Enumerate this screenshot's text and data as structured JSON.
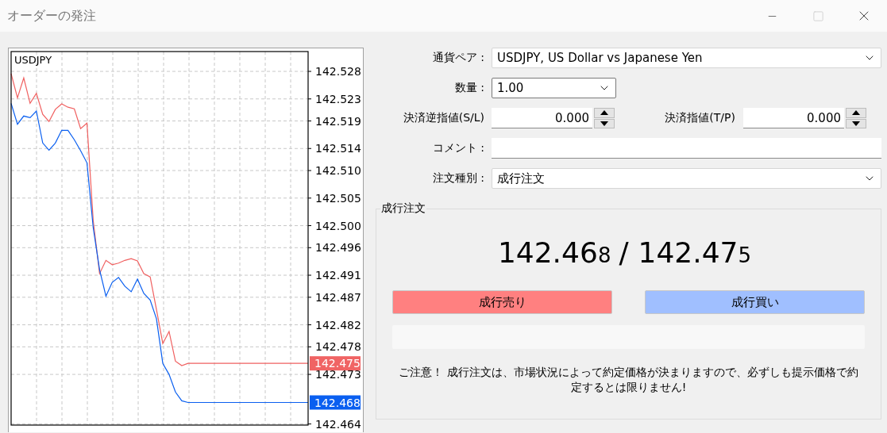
{
  "window": {
    "title": "オーダーの発注",
    "controls": [
      {
        "kind": "minimize",
        "disabled": false
      },
      {
        "kind": "maximize",
        "disabled": true
      },
      {
        "kind": "close",
        "disabled": false
      }
    ]
  },
  "chart": {
    "symbol": "USDJPY",
    "chart_data": {
      "type": "line",
      "categories": [
        null,
        null,
        null,
        null,
        null,
        null,
        null,
        null,
        null,
        null,
        null,
        null,
        null,
        null,
        null,
        null,
        null,
        null,
        null,
        null,
        null,
        null,
        null,
        null,
        null,
        null,
        null,
        null,
        null,
        null,
        null,
        null,
        null,
        null,
        null,
        null,
        null,
        null,
        null,
        null,
        null,
        null,
        null,
        null,
        null,
        null,
        null,
        null
      ],
      "series": [
        {
          "color": "#f06060",
          "values": [
            142.5276,
            142.5232,
            142.5268,
            142.5222,
            142.524,
            142.5202,
            142.5189,
            142.5211,
            142.5221,
            142.5215,
            142.5212,
            142.5176,
            142.5186,
            142.5009,
            142.4913,
            142.4937,
            142.4929,
            142.4932,
            142.4937,
            142.494,
            142.4936,
            142.4913,
            142.4907,
            142.4848,
            142.4786,
            142.4808,
            142.4754,
            142.4746,
            142.475,
            142.475,
            142.475,
            142.475,
            142.475,
            142.475,
            142.475,
            142.475,
            142.475,
            142.475,
            142.475,
            142.475,
            142.475,
            142.475,
            142.475,
            142.475,
            142.475,
            142.475,
            142.475,
            142.475
          ]
        },
        {
          "color": "#0a5ff0",
          "values": [
            142.5222,
            142.5184,
            142.5199,
            142.5196,
            142.5208,
            142.515,
            142.5137,
            142.515,
            142.5173,
            142.5173,
            142.5156,
            142.5136,
            142.5114,
            142.4996,
            142.492,
            142.4872,
            142.4897,
            142.4906,
            142.489,
            142.488,
            142.4903,
            142.4877,
            142.4865,
            142.4831,
            142.475,
            142.473,
            142.4698,
            142.4682,
            142.4679,
            142.4679,
            142.4679,
            142.4679,
            142.4679,
            142.4679,
            142.4679,
            142.4679,
            142.4679,
            142.4679,
            142.4679,
            142.4679,
            142.4679,
            142.4679,
            142.4679,
            142.4679,
            142.4679,
            142.4679,
            142.4679,
            142.4679
          ]
        }
      ],
      "ylim": [
        142.4638,
        142.5316
      ],
      "grid": true,
      "yticks": [
        {
          "value": 142.528,
          "label": "142.528"
        },
        {
          "value": 142.523,
          "label": "142.523"
        },
        {
          "value": 142.519,
          "label": "142.519"
        },
        {
          "value": 142.514,
          "label": "142.514"
        },
        {
          "value": 142.51,
          "label": "142.510"
        },
        {
          "value": 142.505,
          "label": "142.505"
        },
        {
          "value": 142.5,
          "label": "142.500"
        },
        {
          "value": 142.496,
          "label": "142.496"
        },
        {
          "value": 142.491,
          "label": "142.491"
        },
        {
          "value": 142.487,
          "label": "142.487"
        },
        {
          "value": 142.482,
          "label": "142.482"
        },
        {
          "value": 142.478,
          "label": "142.478"
        },
        {
          "value": 142.473,
          "label": "142.473"
        },
        {
          "value": 142.464,
          "label": "142.464"
        }
      ]
    },
    "price_tags": [
      {
        "label": "142.475",
        "color": "#f06464"
      },
      {
        "label": "142.468",
        "color": "#0a5ff0"
      }
    ]
  },
  "form": {
    "symbol": {
      "label": "通貨ペア :",
      "value": "USDJPY, US Dollar vs Japanese Yen"
    },
    "volume": {
      "label": "数量 :",
      "value": "1.00"
    },
    "stop_loss": {
      "label": "決済逆指値(S/L)",
      "value": "0.000"
    },
    "take_profit": {
      "label": "決済指値(T/P)",
      "value": "0.000"
    },
    "comment": {
      "label": "コメント :"
    },
    "order_type": {
      "label": "注文種別 :",
      "value": "成行注文"
    }
  },
  "order": {
    "title": "成行注文",
    "bid": {
      "main": "142.46",
      "pip": "8"
    },
    "separator": "/",
    "ask": {
      "main": "142.47",
      "pip": "5"
    },
    "buttons": [
      {
        "kind": "sell",
        "label": "成行売り"
      },
      {
        "kind": "buy",
        "label": "成行買い"
      }
    ],
    "progress": {
      "level": 0
    },
    "notice": "ご注意！ 成行注文は、市場状況によって約定価格が決まりますので、必ずしも提示価格で約定するとは限りません!"
  }
}
